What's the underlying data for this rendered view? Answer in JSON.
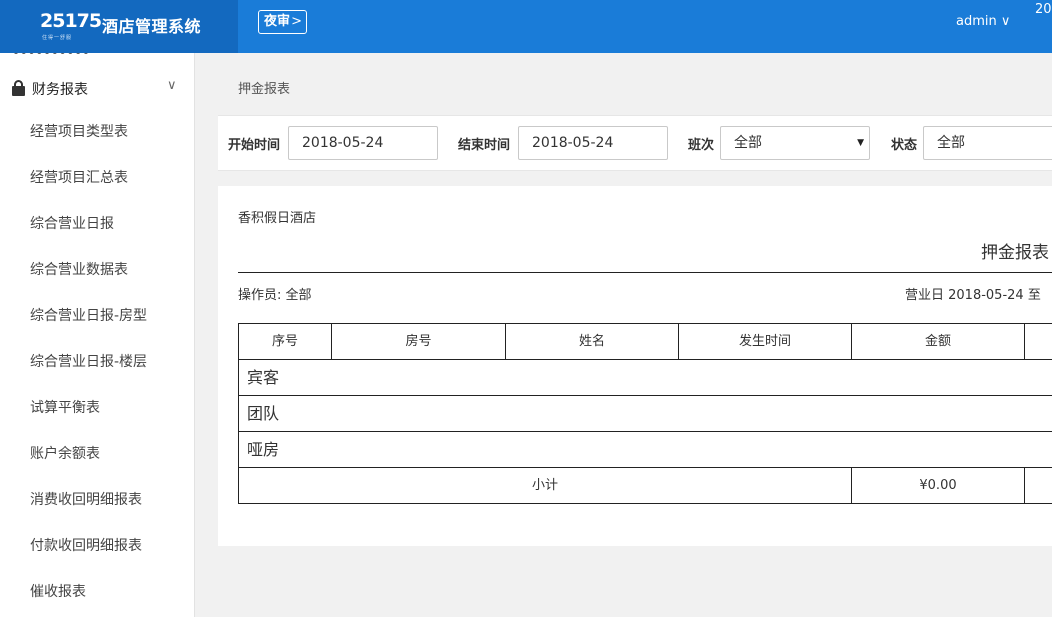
{
  "app": {
    "logo_text": "25175",
    "logo_sub": "住得一舒服",
    "name": "酒店管理系统",
    "night_audit": "夜审",
    "night_audit_chevron": ">",
    "user": "admin",
    "user_chevron": "∨",
    "year_fragment": "20"
  },
  "sidebar": {
    "section": "财务报表",
    "section_chevron": "∨",
    "items": [
      "经营项目类型表",
      "经营项目汇总表",
      "综合营业日报",
      "综合营业数据表",
      "综合营业日报-房型",
      "综合营业日报-楼层",
      "试算平衡表",
      "账户余额表",
      "消费收回明细报表",
      "付款收回明细报表",
      "催收报表"
    ]
  },
  "breadcrumb": "押金报表",
  "filters": {
    "start_label": "开始时间",
    "start_value": "2018-05-24",
    "end_label": "结束时间",
    "end_value": "2018-05-24",
    "shift_label": "班次",
    "shift_value": "全部",
    "shift_caret": "▼",
    "status_label": "状态",
    "status_value": "全部"
  },
  "report": {
    "hotel": "香积假日酒店",
    "title": "押金报表",
    "operator": "操作员: 全部",
    "business_day": "营业日 2018-05-24 至",
    "columns": [
      "序号",
      "房号",
      "姓名",
      "发生时间",
      "金额"
    ],
    "groups": [
      "宾客",
      "团队",
      "哑房"
    ],
    "subtotal_label": "小计",
    "subtotal_amount": "¥0.00"
  }
}
